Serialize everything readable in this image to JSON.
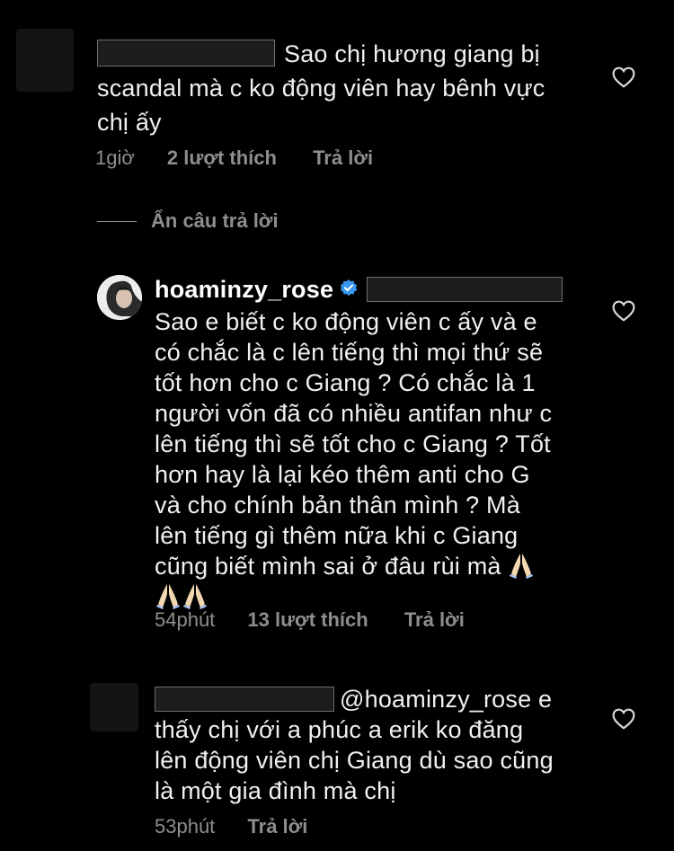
{
  "comments": [
    {
      "text": "Sao chị hương giang bị scandal mà c ko động viên hay bênh vực chị ấy",
      "line1": "Sao chị hương giang bị",
      "line2": "scandal mà c ko động viên hay bênh vực",
      "line3": "chị ấy",
      "time": "1giờ",
      "likes": "2 lượt thích",
      "reply": "Trả lời"
    },
    {
      "username": "hoaminzy_rose",
      "lines": [
        "Sao e biết c ko động viên c ấy và e",
        "có chắc là c lên tiếng thì mọi thứ sẽ",
        "tốt hơn cho c Giang ? Có chắc là 1",
        "người vốn đã có nhiều antifan như c",
        "lên tiếng thì sẽ tốt cho c Giang ? Tốt",
        "hơn hay là lại kéo thêm anti cho G",
        "và cho chính bản thân mình ? Mà",
        "lên tiếng gì thêm nữa khi c Giang",
        "cũng biết mình sai ở đâu rùi mà"
      ],
      "time": "54phút",
      "likes": "13 lượt thích",
      "reply": "Trả lời"
    },
    {
      "mention": "@hoaminzy_rose e",
      "lines": [
        "thấy chị với a phúc a erik ko đăng",
        "lên động viên chị Giang dù sao cũng",
        "là một gia đình mà chị"
      ],
      "time": "53phút",
      "reply": "Trả lời"
    }
  ],
  "hide_replies": "Ẩn câu trả lời",
  "icons": {
    "heart": "heart-outline-icon",
    "verified": "verified-badge-icon",
    "emoji": "folded-hands-emoji"
  },
  "colors": {
    "background": "#000000",
    "text": "#f0f0f0",
    "meta": "#8e8e8e",
    "verified": "#3897f0"
  }
}
